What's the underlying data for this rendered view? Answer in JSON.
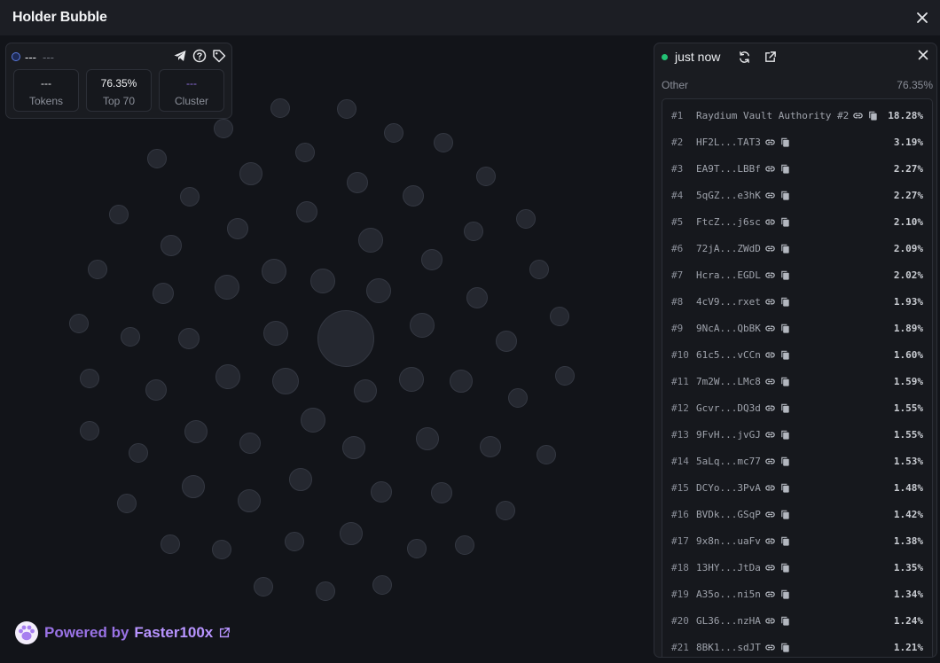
{
  "window": {
    "title": "Holder Bubble"
  },
  "token": {
    "name": "---",
    "symbol": "---"
  },
  "stats": [
    {
      "value": "---",
      "label": "Tokens"
    },
    {
      "value": "76.35%",
      "label": "Top 70"
    },
    {
      "value": "---",
      "label": "Cluster"
    }
  ],
  "panel": {
    "time": "just now",
    "other_label": "Other",
    "other_pct": "76.35%",
    "holders": [
      {
        "rank": "#1",
        "addr": "Raydium Vault Authority #2",
        "pct": "18.28%"
      },
      {
        "rank": "#2",
        "addr": "HF2L...TAT3",
        "pct": "3.19%"
      },
      {
        "rank": "#3",
        "addr": "EA9T...LBBf",
        "pct": "2.27%"
      },
      {
        "rank": "#4",
        "addr": "5qGZ...e3hK",
        "pct": "2.27%"
      },
      {
        "rank": "#5",
        "addr": "FtcZ...j6sc",
        "pct": "2.10%"
      },
      {
        "rank": "#6",
        "addr": "72jA...ZWdD",
        "pct": "2.09%"
      },
      {
        "rank": "#7",
        "addr": "Hcra...EGDL",
        "pct": "2.02%"
      },
      {
        "rank": "#8",
        "addr": "4cV9...rxet",
        "pct": "1.93%"
      },
      {
        "rank": "#9",
        "addr": "9NcA...QbBK",
        "pct": "1.89%"
      },
      {
        "rank": "#10",
        "addr": "61c5...vCCn",
        "pct": "1.60%"
      },
      {
        "rank": "#11",
        "addr": "7m2W...LMc8",
        "pct": "1.59%"
      },
      {
        "rank": "#12",
        "addr": "Gcvr...DQ3d",
        "pct": "1.55%"
      },
      {
        "rank": "#13",
        "addr": "9FvH...jvGJ",
        "pct": "1.55%"
      },
      {
        "rank": "#14",
        "addr": "5aLq...mc77",
        "pct": "1.53%"
      },
      {
        "rank": "#15",
        "addr": "DCYo...3PvA",
        "pct": "1.48%"
      },
      {
        "rank": "#16",
        "addr": "BVDk...GSqP",
        "pct": "1.42%"
      },
      {
        "rank": "#17",
        "addr": "9x8n...uaFv",
        "pct": "1.38%"
      },
      {
        "rank": "#18",
        "addr": "13HY...JtDa",
        "pct": "1.35%"
      },
      {
        "rank": "#19",
        "addr": "A35o...ni5n",
        "pct": "1.34%"
      },
      {
        "rank": "#20",
        "addr": "GL36...nzHA",
        "pct": "1.24%"
      },
      {
        "rank": "#21",
        "addr": "8BK1...sdJT",
        "pct": "1.21%"
      }
    ]
  },
  "footer": {
    "powered_prefix": "Powered by",
    "brand": "Faster100x"
  },
  "colors": {
    "accent": "#9a73e6",
    "live": "#23c275",
    "bubble": "#252830"
  }
}
